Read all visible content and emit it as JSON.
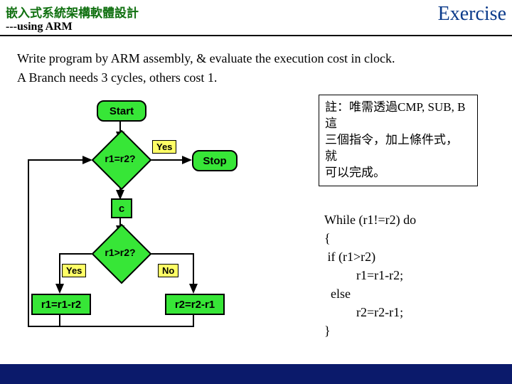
{
  "header": {
    "title_zh": "嵌入式系統架構軟體設計",
    "subtitle": "---using ARM",
    "right": "Exercise"
  },
  "instruction": {
    "line1": "Write program by ARM assembly, & evaluate the execution cost in clock.",
    "line2": "A Branch needs 3 cycles, others cost 1."
  },
  "flow": {
    "start": "Start",
    "stop": "Stop",
    "d1": "r1=r2?",
    "d2": "r1>r2?",
    "c": "c",
    "a1": "r1=r1-r2",
    "a2": "r2=r2-r1",
    "yes1": "Yes",
    "yes2": "Yes",
    "no": "No"
  },
  "note": {
    "l1": "註：唯需透過CMP, SUB, B這",
    "l2": "三個指令，加上條件式， 就",
    "l3": "可以完成。"
  },
  "code": {
    "l1": "While (r1!=r2) do",
    "l2": "{",
    "l3": " if (r1>r2)",
    "l4": "          r1=r1-r2;",
    "l5": "  else",
    "l6": "          r2=r2-r1;",
    "l7": "}"
  }
}
